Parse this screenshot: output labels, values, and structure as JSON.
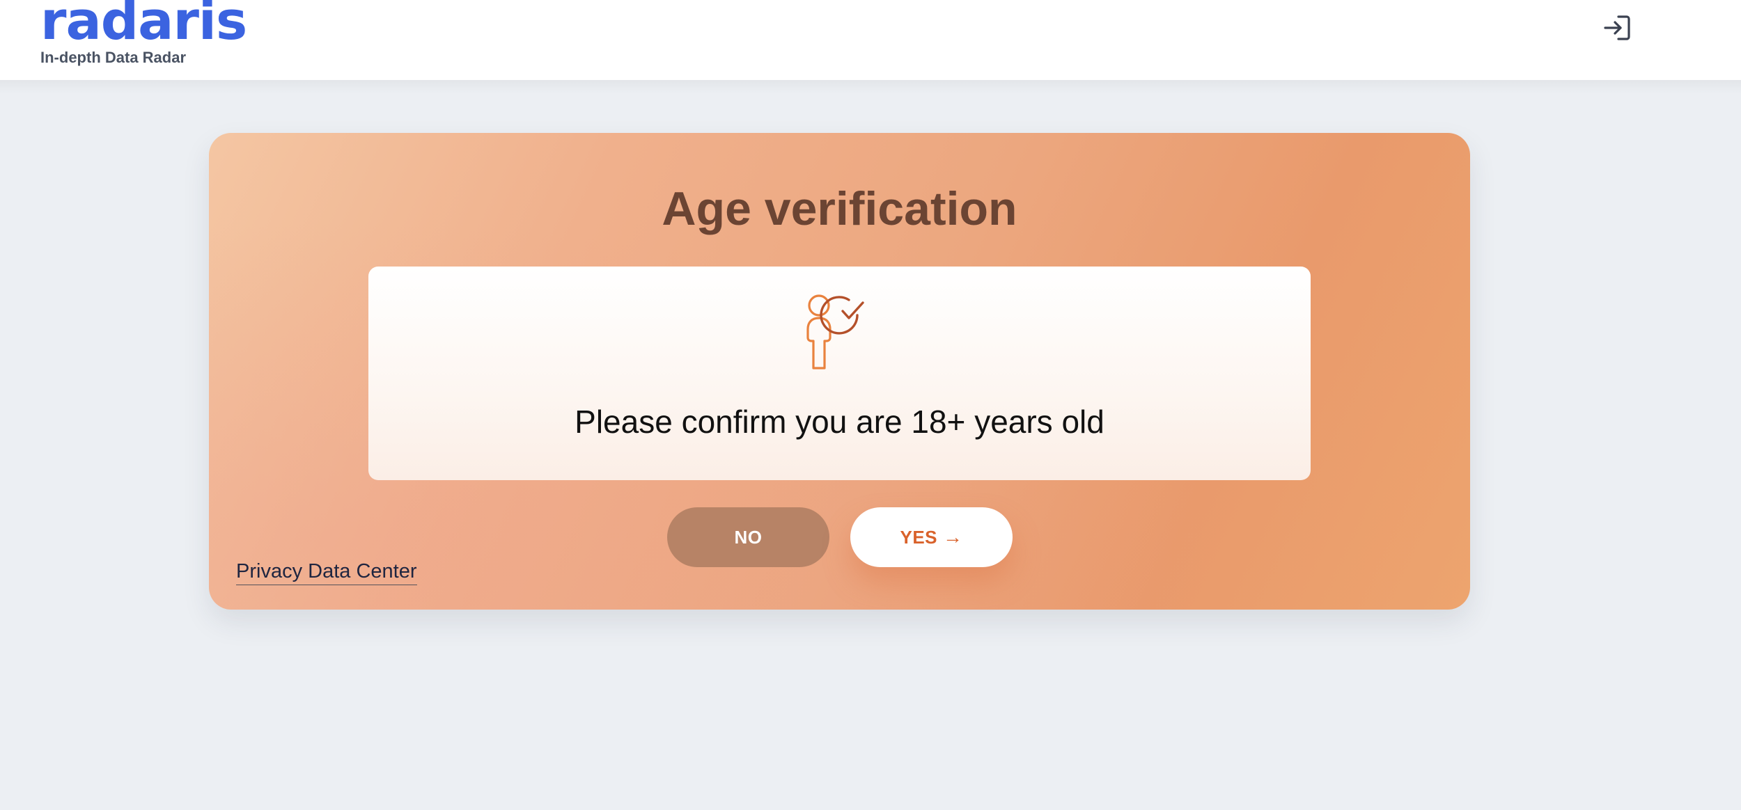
{
  "header": {
    "logo_text": "radaris",
    "tagline": "In-depth Data Radar",
    "login_icon": "login-icon"
  },
  "modal": {
    "title": "Age verification",
    "icon": "person-check-icon",
    "confirm_text": "Please confirm you are 18+ years old",
    "no_label": "NO",
    "yes_label": "YES",
    "yes_arrow": "→",
    "privacy_link": "Privacy Data Center"
  },
  "colors": {
    "brand_blue": "#3b63e0",
    "title_brown": "#6b4433",
    "no_button": "#b78366",
    "yes_text": "#d9622b",
    "card_gradient_start": "#f4c6a3",
    "card_gradient_end": "#e99a6c",
    "page_background": "#eceff3"
  }
}
